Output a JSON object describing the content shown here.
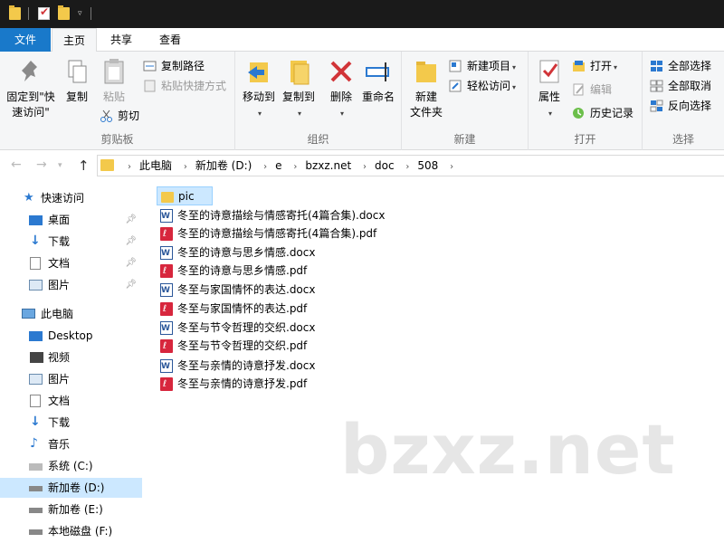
{
  "ribbon_tabs": {
    "file": "文件",
    "home": "主页",
    "share": "共享",
    "view": "查看"
  },
  "clipboard": {
    "pin": "固定到\"快速访问\"",
    "copy": "复制",
    "paste": "粘贴",
    "copy_path": "复制路径",
    "paste_shortcut": "粘贴快捷方式",
    "cut": "剪切",
    "label": "剪贴板"
  },
  "organize": {
    "move_to": "移动到",
    "copy_to": "复制到",
    "delete": "删除",
    "rename": "重命名",
    "label": "组织"
  },
  "new": {
    "new_folder": "新建\n文件夹",
    "new_item": "新建项目",
    "easy_access": "轻松访问",
    "label": "新建"
  },
  "open": {
    "properties": "属性",
    "open": "打开",
    "edit": "编辑",
    "history": "历史记录",
    "label": "打开"
  },
  "select": {
    "select_all": "全部选择",
    "select_none": "全部取消",
    "invert": "反向选择",
    "label": "选择"
  },
  "breadcrumbs": [
    "此电脑",
    "新加卷 (D:)",
    "e",
    "bzxz.net",
    "doc",
    "508"
  ],
  "sidebar": {
    "quick_access": "快速访问",
    "quick_items": [
      "桌面",
      "下载",
      "文档",
      "图片"
    ],
    "this_pc": "此电脑",
    "pc_items": [
      "Desktop",
      "视频",
      "图片",
      "文档",
      "下载",
      "音乐",
      "系统 (C:)",
      "新加卷 (D:)",
      "新加卷 (E:)",
      "本地磁盘 (F:)"
    ]
  },
  "files": [
    {
      "name": "pic",
      "type": "folder"
    },
    {
      "name": "冬至的诗意描绘与情感寄托(4篇合集).docx",
      "type": "word"
    },
    {
      "name": "冬至的诗意描绘与情感寄托(4篇合集).pdf",
      "type": "pdf"
    },
    {
      "name": "冬至的诗意与思乡情感.docx",
      "type": "word"
    },
    {
      "name": "冬至的诗意与思乡情感.pdf",
      "type": "pdf"
    },
    {
      "name": "冬至与家国情怀的表达.docx",
      "type": "word"
    },
    {
      "name": "冬至与家国情怀的表达.pdf",
      "type": "pdf"
    },
    {
      "name": "冬至与节令哲理的交织.docx",
      "type": "word"
    },
    {
      "name": "冬至与节令哲理的交织.pdf",
      "type": "pdf"
    },
    {
      "name": "冬至与亲情的诗意抒发.docx",
      "type": "word"
    },
    {
      "name": "冬至与亲情的诗意抒发.pdf",
      "type": "pdf"
    }
  ],
  "watermark": "bzxz.net",
  "colors": {
    "accent": "#1979ca",
    "selection": "#cce8ff",
    "folder": "#f3c94b",
    "pdf": "#d7263d",
    "word": "#2b579a"
  }
}
